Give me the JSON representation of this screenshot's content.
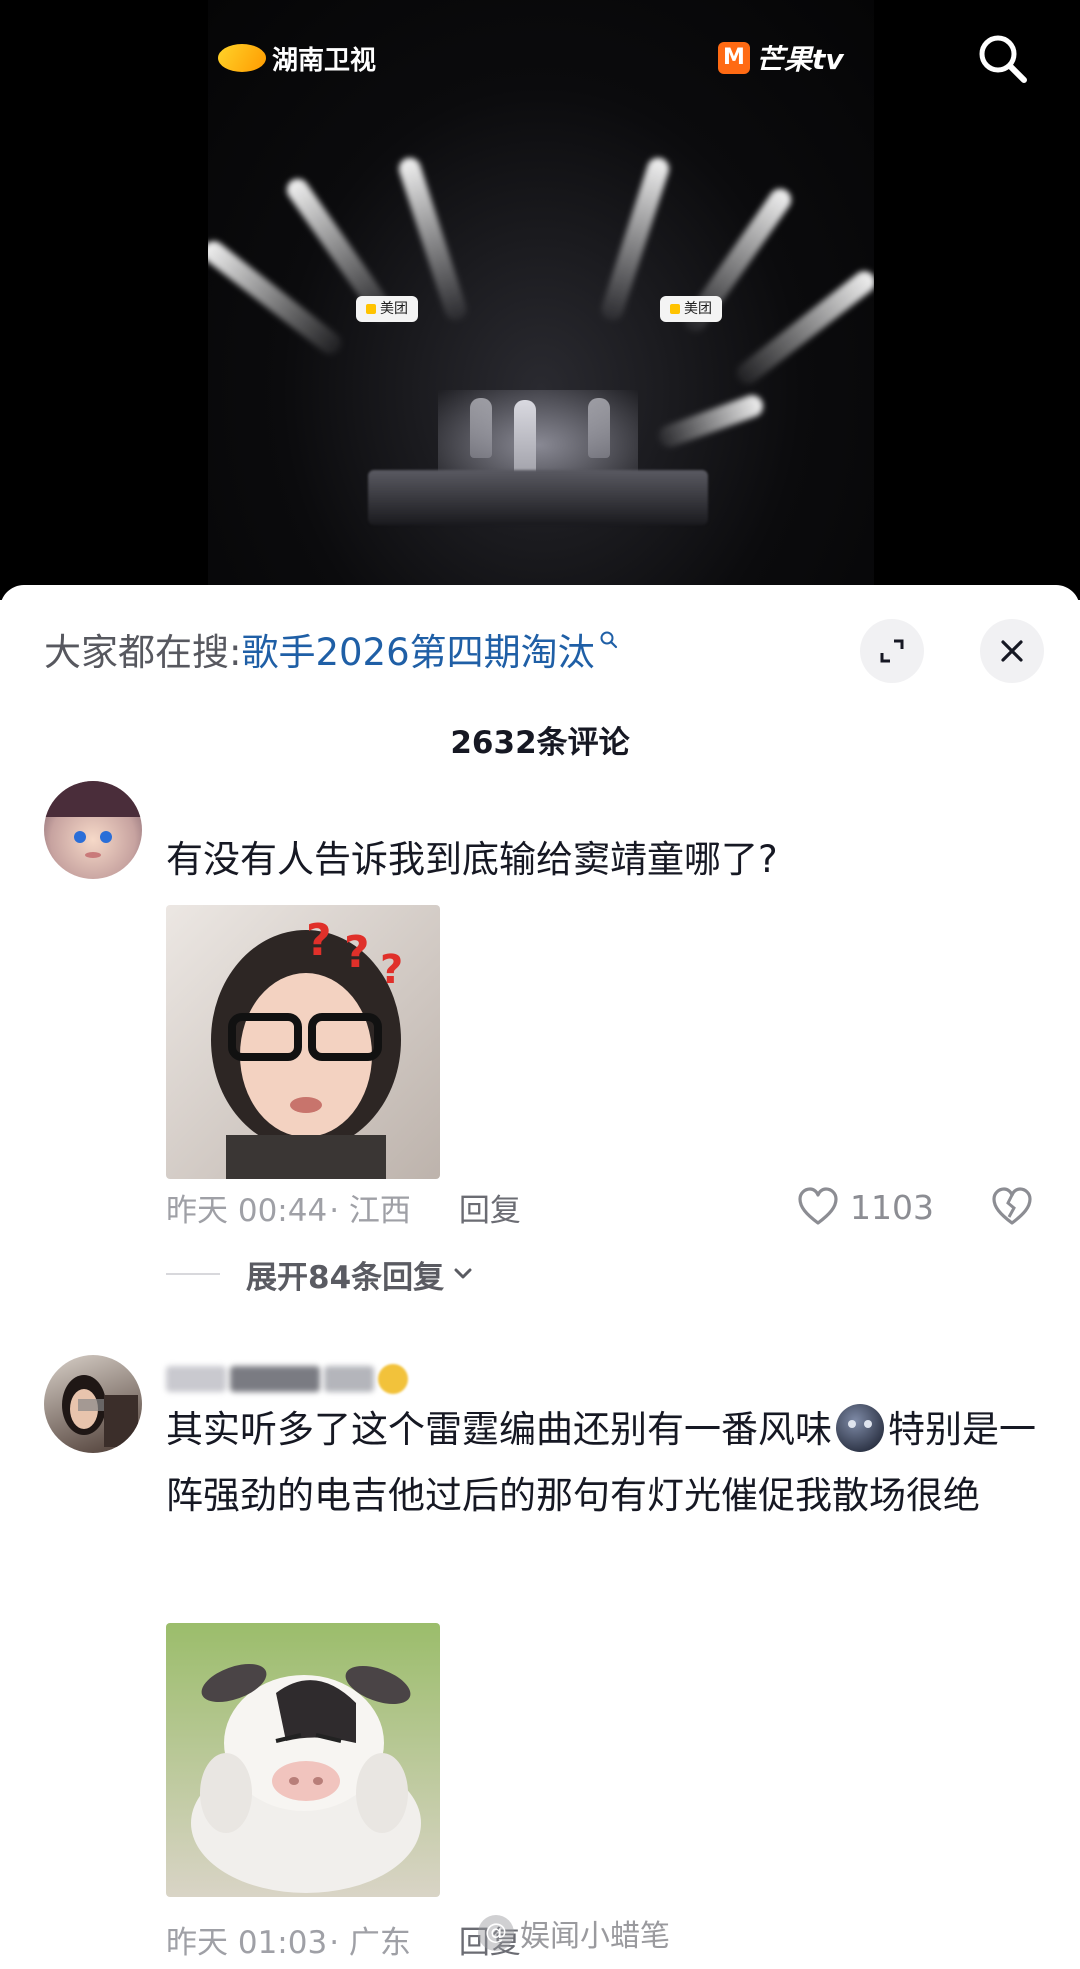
{
  "video": {
    "channel_logo": "湖南卫视",
    "platform_logo": "芒果tv",
    "sponsor_tags": [
      "美团",
      "美团"
    ],
    "icons": {
      "search": "search-icon"
    }
  },
  "search_hint": {
    "prefix": "大家都在搜:",
    "query": "歌手2026第四期淘汰",
    "icons": {
      "query": "mini-search-icon",
      "expand": "expand-icon",
      "close": "close-icon"
    }
  },
  "comments_header": {
    "count_label": "2632条评论"
  },
  "comments": [
    {
      "text": "有没有人告诉我到底输给窦靖童哪了?",
      "time": "昨天 00:44",
      "location": "· 江西",
      "reply_label": "回复",
      "likes": "1103",
      "expand_replies": "展开84条回复",
      "sticker": "confused-woman-sticker"
    },
    {
      "username": "",
      "text_part1": "其实听多了这个雷霆编曲还别有一番风味",
      "text_part2": "特别是一阵强劲的电吉他过后的那句有灯光催促我散场很绝",
      "time": "昨天 01:03",
      "location": "· 广东",
      "reply_label": "回复",
      "sticker": "frustrated-cow-sticker"
    }
  ],
  "watermark": {
    "text": "娱闻小蜡笔"
  },
  "colors": {
    "link": "#1f5fa6",
    "meta": "#9fa0a6",
    "text": "#161823"
  }
}
